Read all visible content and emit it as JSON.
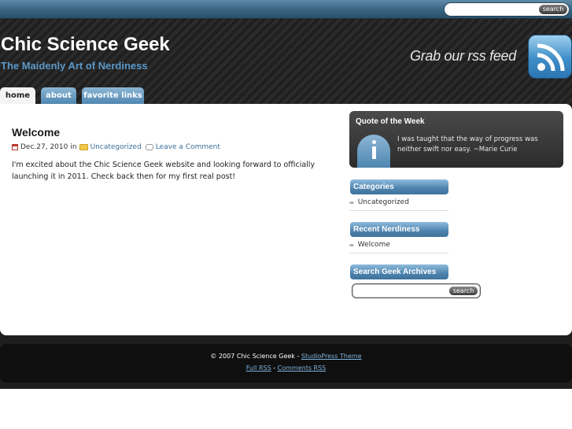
{
  "topbar": {
    "search_button_label": "search"
  },
  "header": {
    "site_title": "Chic Science Geek",
    "tagline": "The Maidenly Art of Nerdiness",
    "rss_promo": "Grab our rss feed",
    "rss_icon": "rss-feed-icon"
  },
  "nav": {
    "tabs": [
      {
        "label": "home",
        "active": true
      },
      {
        "label": "about",
        "active": false
      },
      {
        "label": "favorite links",
        "active": false
      }
    ]
  },
  "post": {
    "title": "Welcome",
    "date": "Dec.27, 2010",
    "in_word": "in",
    "category": "Uncategorized",
    "comment_link": "Leave a Comment",
    "body": "I'm excited about the Chic Science Geek website and looking forward to officially launching it in 2011.  Check back then for my first real post!"
  },
  "sidebar": {
    "quote": {
      "title": "Quote of the Week",
      "text": "I was taught that the way of progress was neither swift nor easy. ~Marie Curie"
    },
    "categories": {
      "title": "Categories",
      "items": [
        "Uncategorized"
      ]
    },
    "recent": {
      "title": "Recent Nerdiness",
      "items": [
        "Welcome"
      ]
    },
    "search": {
      "title": "Search Geek Archives",
      "button_label": "search"
    }
  },
  "footer": {
    "copyright": "© 2007 Chic Science Geek -",
    "theme_link": "StudioPress Theme",
    "full_rss": "Full RSS",
    "separator": "-",
    "comments_rss": "Comments RSS"
  },
  "colors": {
    "accent_blue": "#4f86b0",
    "tagline_blue": "#5b98c8",
    "link_blue": "#3a6f9a",
    "header_dark": "#232323"
  }
}
